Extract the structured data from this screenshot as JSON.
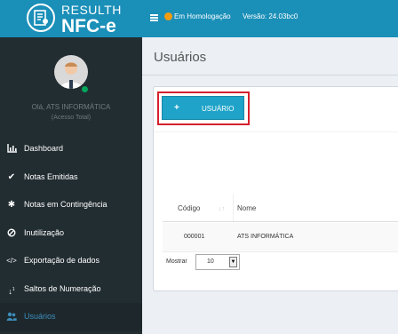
{
  "brand": {
    "top": "RESULTH",
    "bottom": "NFC-e"
  },
  "topbar": {
    "environment": "Em Homologação",
    "version": "Versão: 24.03bc0"
  },
  "user": {
    "greeting": "Olá, ATS INFORMÁTICA",
    "access": "(Acesso Total)"
  },
  "sidebar": {
    "items": [
      {
        "label": "Dashboard",
        "icon": "bar-chart-icon"
      },
      {
        "label": "Notas Emitidas",
        "icon": "check-icon"
      },
      {
        "label": "Notas em Contingência",
        "icon": "asterisk-icon"
      },
      {
        "label": "Inutilização",
        "icon": "ban-icon"
      },
      {
        "label": "Exportação de dados",
        "icon": "code-icon"
      },
      {
        "label": "Saltos de Numeração",
        "icon": "sort-numeric-icon"
      },
      {
        "label": "Usuários",
        "icon": "users-icon",
        "active": true
      }
    ]
  },
  "page": {
    "title": "Usuários"
  },
  "toolbar": {
    "add_label": "USUÁRIO",
    "add_icon": "+"
  },
  "table": {
    "headers": [
      "Código",
      "Nome"
    ],
    "rows": [
      [
        "000001",
        "ATS INFORMÁTICA"
      ]
    ]
  },
  "pager": {
    "show_label": "Mostrar",
    "page_size": "10"
  },
  "colors": {
    "header": "#1a8fb8",
    "sidebar": "#222d32",
    "button": "#1fa3c8",
    "highlight": "#d6202e"
  }
}
